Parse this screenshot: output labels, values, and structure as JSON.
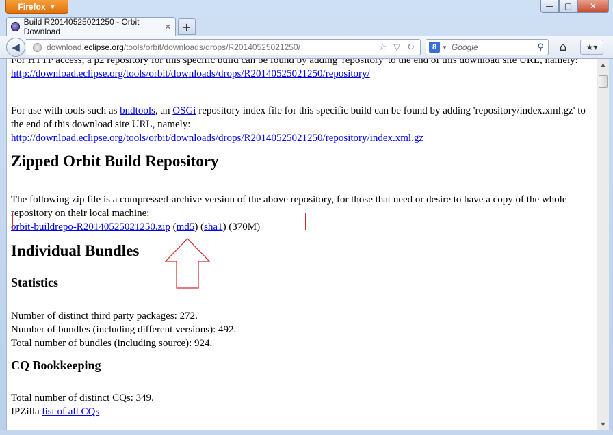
{
  "browser": {
    "menu_button": "Firefox",
    "window_controls": {
      "minimize": "—",
      "maximize": "▢",
      "close": "✕"
    },
    "tab": {
      "title": "Build R20140525021250 - Orbit Download",
      "close": "✕"
    },
    "new_tab": "+",
    "url": {
      "pre": "download.",
      "host": "eclipse.org",
      "post": "/tools/orbit/downloads/drops/R20140525021250/"
    },
    "search": {
      "engine_label": "8",
      "placeholder": "Google"
    }
  },
  "page": {
    "p1": {
      "text": "For HTTP access, a p2 repository for this specific build can be found by adding 'repository' to the end of this download site URL, namely:",
      "link": "http://download.eclipse.org/tools/orbit/downloads/drops/R20140525021250/repository/"
    },
    "p2": {
      "t1": "For use with tools such as ",
      "link_bndtools": "bndtools",
      "t2": ", an ",
      "link_osgi": "OSGi",
      "t3": " repository index file for this specific build can be found by adding 'repository/index.xml.gz' to the end of this download site URL, namely:",
      "link": "http://download.eclipse.org/tools/orbit/downloads/drops/R20140525021250/repository/index.xml.gz"
    },
    "zipped_heading": "Zipped Orbit Build Repository",
    "zipped_text": "The following zip file is a compressed-archive version of the above repository, for those that need or desire to have a copy of the whole repository on their local machine:",
    "zip": {
      "file": "orbit-buildrepo-R20140525021250.zip",
      "open1": " (",
      "md5": "md5",
      "mid": ") (",
      "sha1": "sha1",
      "size": ") (370M)"
    },
    "individual_heading": "Individual Bundles",
    "statistics_heading": "Statistics",
    "stats": [
      "Number of distinct third party packages: 272.",
      "Number of bundles (including different versions): 492.",
      "Total number of bundles (including source): 924."
    ],
    "cq_heading": "CQ Bookkeeping",
    "cq_total": "Total number of distinct CQs: 349.",
    "ipzilla_label": "IPZilla ",
    "ipzilla_link": "list of all CQs"
  },
  "colors": {
    "link": "#0000ee",
    "annotation_red": "#d42a2a",
    "firefox_orange": "#e0700d"
  }
}
